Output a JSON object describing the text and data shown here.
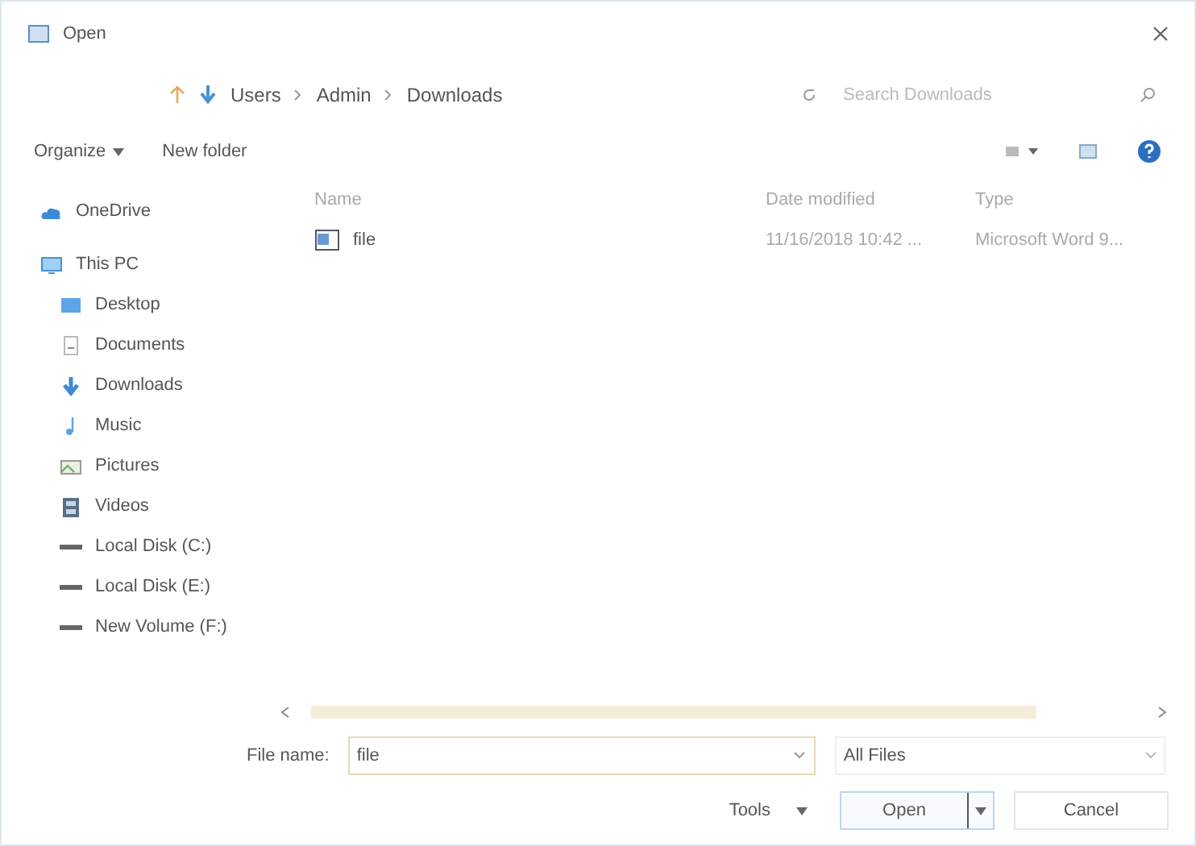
{
  "window": {
    "title": "Open"
  },
  "address": {
    "path": [
      "Users",
      "Admin",
      "Downloads"
    ],
    "search_placeholder": "Search Downloads"
  },
  "toolbar": {
    "organize": "Organize",
    "new_folder": "New folder"
  },
  "sidebar": {
    "items": [
      {
        "label": "OneDrive",
        "kind": "cloud"
      },
      {
        "label": "This PC",
        "kind": "pc",
        "children": [
          {
            "label": "Desktop",
            "kind": "desktop"
          },
          {
            "label": "Documents",
            "kind": "documents"
          },
          {
            "label": "Downloads",
            "kind": "downloads"
          },
          {
            "label": "Music",
            "kind": "music"
          },
          {
            "label": "Pictures",
            "kind": "pictures"
          },
          {
            "label": "Videos",
            "kind": "videos"
          },
          {
            "label": "Local Disk (C:)",
            "kind": "disk"
          },
          {
            "label": "Local Disk (E:)",
            "kind": "disk"
          },
          {
            "label": "New Volume (F:)",
            "kind": "disk"
          }
        ]
      }
    ]
  },
  "table": {
    "columns": [
      "Name",
      "Date modified",
      "Type"
    ],
    "rows": [
      {
        "name": "file",
        "date": "11/16/2018 10:42 ...",
        "type": "Microsoft Word 9..."
      }
    ]
  },
  "footer": {
    "file_name_label": "File name:",
    "file_name": "file",
    "filter": "All Files",
    "tools": "Tools",
    "open": "Open",
    "cancel": "Cancel"
  }
}
